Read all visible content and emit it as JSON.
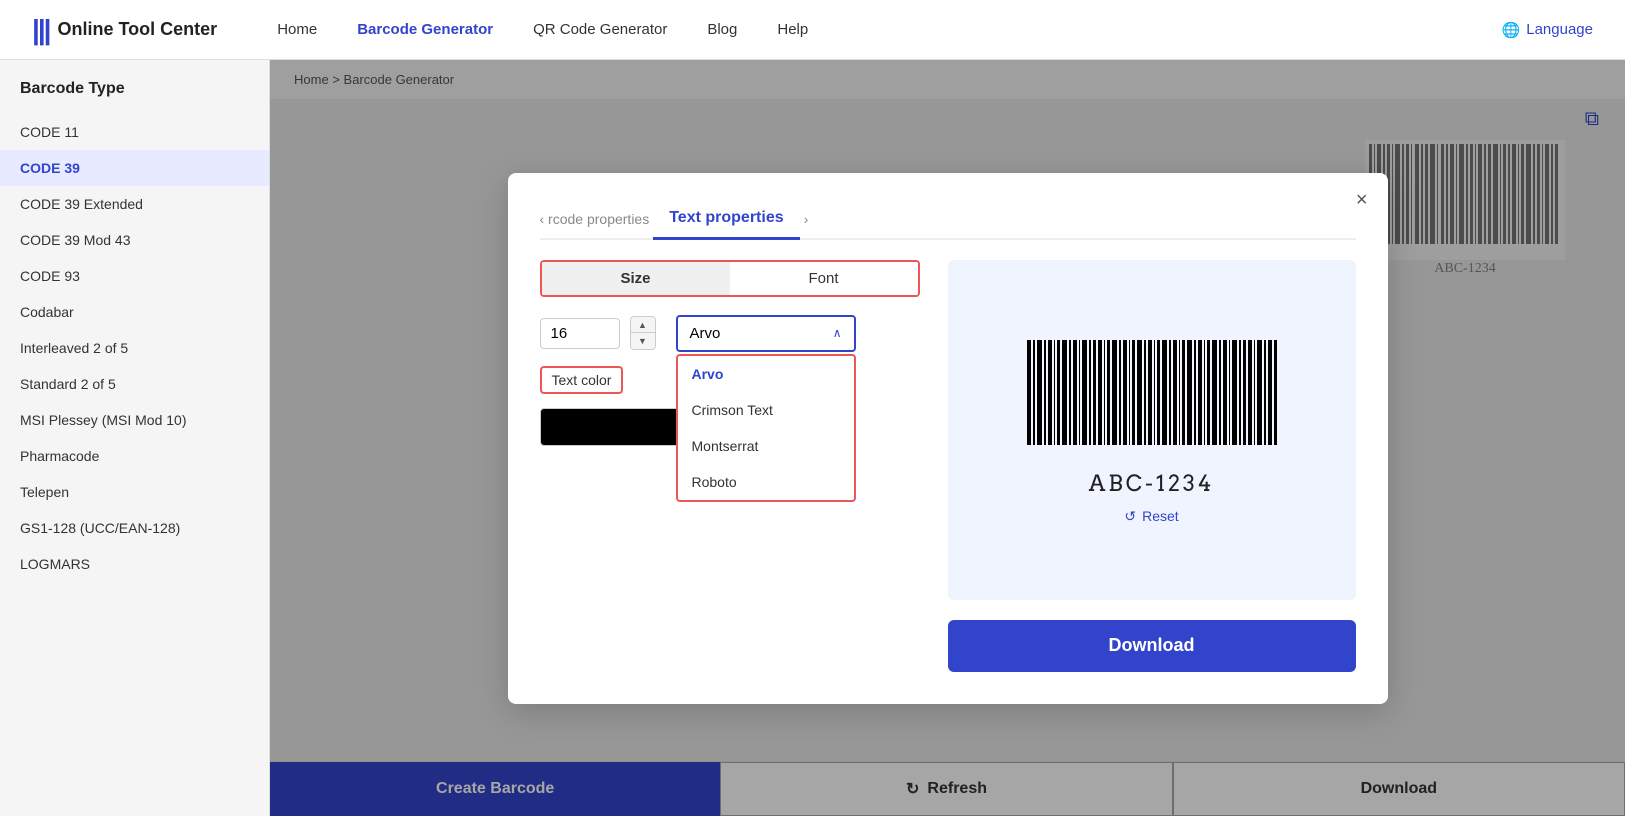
{
  "navbar": {
    "logo_text": "Online Tool Center",
    "links": [
      {
        "label": "Home",
        "active": false
      },
      {
        "label": "Barcode Generator",
        "active": true
      },
      {
        "label": "QR Code Generator",
        "active": false
      },
      {
        "label": "Blog",
        "active": false
      },
      {
        "label": "Help",
        "active": false
      }
    ],
    "language_label": "Language"
  },
  "sidebar": {
    "title": "Barcode Type",
    "items": [
      {
        "label": "CODE 11",
        "active": false
      },
      {
        "label": "CODE 39",
        "active": true
      },
      {
        "label": "CODE 39 Extended",
        "active": false
      },
      {
        "label": "CODE 39 Mod 43",
        "active": false
      },
      {
        "label": "CODE 93",
        "active": false
      },
      {
        "label": "Codabar",
        "active": false
      },
      {
        "label": "Interleaved 2 of 5",
        "active": false
      },
      {
        "label": "Standard 2 of 5",
        "active": false
      },
      {
        "label": "MSI Plessey (MSI Mod 10)",
        "active": false
      },
      {
        "label": "Pharmacode",
        "active": false
      },
      {
        "label": "Telepen",
        "active": false
      },
      {
        "label": "GS1-128 (UCC/EAN-128)",
        "active": false
      },
      {
        "label": "LOGMARS",
        "active": false
      }
    ]
  },
  "breadcrumb": {
    "parts": [
      "Home",
      "Barcode Generator"
    ]
  },
  "bottom_bar": {
    "create_label": "Create Barcode",
    "refresh_label": "Refresh",
    "download_label": "Download"
  },
  "modal": {
    "close_label": "×",
    "prev_tab_label": "‹ rcode properties",
    "active_tab_label": "Text properties",
    "next_arrow": "›",
    "size_tab_label": "Size",
    "font_tab_label": "Font",
    "size_value": "16",
    "font_selected": "Arvo",
    "font_options": [
      {
        "label": "Arvo",
        "selected": true
      },
      {
        "label": "Crimson Text",
        "selected": false
      },
      {
        "label": "Montserrat",
        "selected": false
      },
      {
        "label": "Roboto",
        "selected": false
      }
    ],
    "text_color_label": "Text color",
    "color_swatch": "#000000",
    "reset_label": "Reset",
    "download_label": "Download",
    "barcode_value": "ABC-1234"
  },
  "icons": {
    "globe": "🌐",
    "copy": "⧉",
    "refresh": "↻",
    "reset": "↺",
    "up_arrow": "▲",
    "down_arrow": "▼",
    "chevron_down": "∨"
  },
  "colors": {
    "primary": "#3344cc",
    "border_red": "#e55",
    "preview_bg": "#f0f4ff"
  }
}
